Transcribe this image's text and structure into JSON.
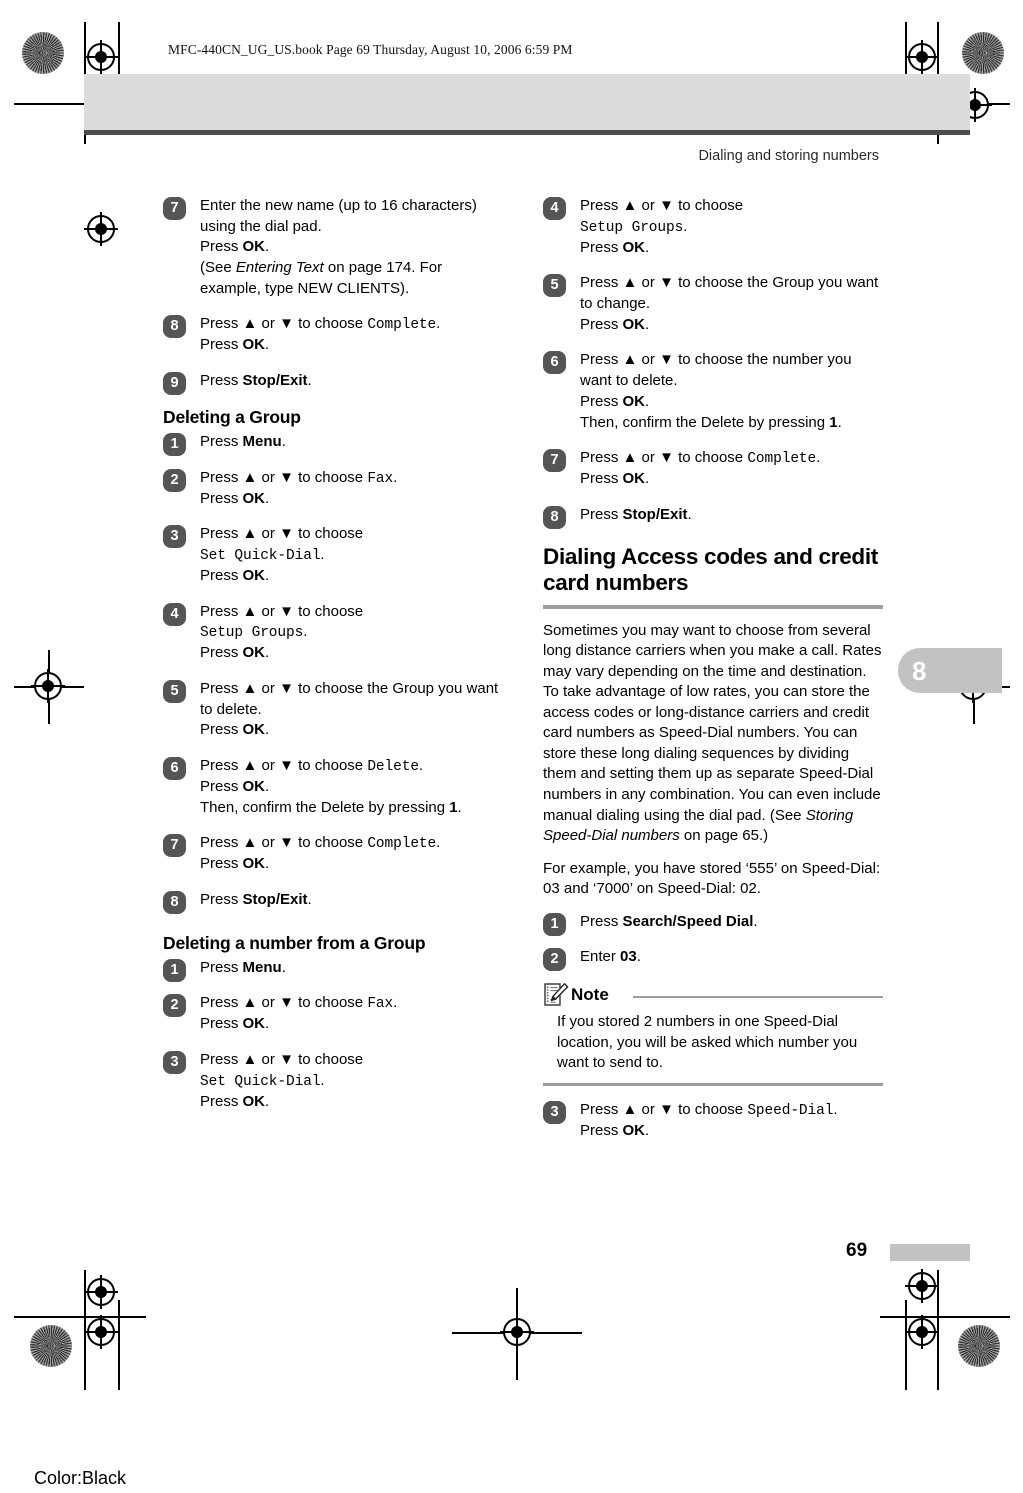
{
  "print_marks": {
    "book_line": "MFC-440CN_UG_US.book  Page 69  Thursday, August 10, 2006  6:59 PM",
    "color_note": "Color:Black"
  },
  "header": {
    "running_head": "Dialing and storing numbers"
  },
  "chapter_tab": {
    "number": "8"
  },
  "footer": {
    "page_number": "69"
  },
  "left_column": {
    "continued_steps": [
      {
        "number": "7",
        "lines": [
          [
            {
              "t": "Enter the new name (up to 16 characters) using the dial pad.",
              "s": "plain"
            }
          ],
          [
            {
              "t": "Press ",
              "s": "plain"
            },
            {
              "t": "OK",
              "s": "bold"
            },
            {
              "t": ".",
              "s": "plain"
            }
          ],
          [
            {
              "t": "(See ",
              "s": "plain"
            },
            {
              "t": "Entering Text",
              "s": "italic"
            },
            {
              "t": " on page 174. For example, type NEW CLIENTS).",
              "s": "plain"
            }
          ]
        ]
      },
      {
        "number": "8",
        "lines": [
          [
            {
              "t": "Press ",
              "s": "plain"
            },
            {
              "t": "▲",
              "s": "bold"
            },
            {
              "t": " or ",
              "s": "plain"
            },
            {
              "t": "▼",
              "s": "bold"
            },
            {
              "t": " to choose ",
              "s": "plain"
            },
            {
              "t": "Complete",
              "s": "lcd"
            },
            {
              "t": ".",
              "s": "plain"
            }
          ],
          [
            {
              "t": "Press ",
              "s": "plain"
            },
            {
              "t": "OK",
              "s": "bold"
            },
            {
              "t": ".",
              "s": "plain"
            }
          ]
        ]
      },
      {
        "number": "9",
        "lines": [
          [
            {
              "t": "Press ",
              "s": "plain"
            },
            {
              "t": "Stop/Exit",
              "s": "bold"
            },
            {
              "t": ".",
              "s": "plain"
            }
          ]
        ]
      }
    ],
    "section_deleting_group": {
      "heading": "Deleting a Group",
      "steps": [
        {
          "number": "1",
          "lines": [
            [
              {
                "t": "Press ",
                "s": "plain"
              },
              {
                "t": "Menu",
                "s": "bold"
              },
              {
                "t": ".",
                "s": "plain"
              }
            ]
          ]
        },
        {
          "number": "2",
          "lines": [
            [
              {
                "t": "Press ",
                "s": "plain"
              },
              {
                "t": "▲",
                "s": "bold"
              },
              {
                "t": " or ",
                "s": "plain"
              },
              {
                "t": "▼",
                "s": "bold"
              },
              {
                "t": " to choose ",
                "s": "plain"
              },
              {
                "t": "Fax",
                "s": "lcd"
              },
              {
                "t": ".",
                "s": "plain"
              }
            ],
            [
              {
                "t": "Press ",
                "s": "plain"
              },
              {
                "t": "OK",
                "s": "bold"
              },
              {
                "t": ".",
                "s": "plain"
              }
            ]
          ]
        },
        {
          "number": "3",
          "lines": [
            [
              {
                "t": "Press ",
                "s": "plain"
              },
              {
                "t": "▲",
                "s": "bold"
              },
              {
                "t": " or ",
                "s": "plain"
              },
              {
                "t": "▼",
                "s": "bold"
              },
              {
                "t": " to choose",
                "s": "plain"
              }
            ],
            [
              {
                "t": "Set Quick-Dial",
                "s": "lcd"
              },
              {
                "t": ".",
                "s": "plain"
              }
            ],
            [
              {
                "t": "Press ",
                "s": "plain"
              },
              {
                "t": "OK",
                "s": "bold"
              },
              {
                "t": ".",
                "s": "plain"
              }
            ]
          ]
        },
        {
          "number": "4",
          "lines": [
            [
              {
                "t": "Press ",
                "s": "plain"
              },
              {
                "t": "▲",
                "s": "bold"
              },
              {
                "t": " or ",
                "s": "plain"
              },
              {
                "t": "▼",
                "s": "bold"
              },
              {
                "t": " to choose",
                "s": "plain"
              }
            ],
            [
              {
                "t": "Setup Groups",
                "s": "lcd"
              },
              {
                "t": ".",
                "s": "plain"
              }
            ],
            [
              {
                "t": "Press ",
                "s": "plain"
              },
              {
                "t": "OK",
                "s": "bold"
              },
              {
                "t": ".",
                "s": "plain"
              }
            ]
          ]
        },
        {
          "number": "5",
          "lines": [
            [
              {
                "t": "Press ",
                "s": "plain"
              },
              {
                "t": "▲",
                "s": "bold"
              },
              {
                "t": " or ",
                "s": "plain"
              },
              {
                "t": "▼",
                "s": "bold"
              },
              {
                "t": " to choose the Group you want to delete.",
                "s": "plain"
              }
            ],
            [
              {
                "t": "Press ",
                "s": "plain"
              },
              {
                "t": "OK",
                "s": "bold"
              },
              {
                "t": ".",
                "s": "plain"
              }
            ]
          ]
        },
        {
          "number": "6",
          "lines": [
            [
              {
                "t": "Press ",
                "s": "plain"
              },
              {
                "t": "▲",
                "s": "bold"
              },
              {
                "t": " or ",
                "s": "plain"
              },
              {
                "t": "▼",
                "s": "bold"
              },
              {
                "t": " to choose ",
                "s": "plain"
              },
              {
                "t": "Delete",
                "s": "lcd"
              },
              {
                "t": ".",
                "s": "plain"
              }
            ],
            [
              {
                "t": "Press ",
                "s": "plain"
              },
              {
                "t": "OK",
                "s": "bold"
              },
              {
                "t": ".",
                "s": "plain"
              }
            ],
            [
              {
                "t": "Then, confirm the Delete by pressing ",
                "s": "plain"
              },
              {
                "t": "1",
                "s": "bold"
              },
              {
                "t": ".",
                "s": "plain"
              }
            ]
          ]
        },
        {
          "number": "7",
          "lines": [
            [
              {
                "t": "Press ",
                "s": "plain"
              },
              {
                "t": "▲",
                "s": "bold"
              },
              {
                "t": " or ",
                "s": "plain"
              },
              {
                "t": "▼",
                "s": "bold"
              },
              {
                "t": " to choose ",
                "s": "plain"
              },
              {
                "t": "Complete",
                "s": "lcd"
              },
              {
                "t": ".",
                "s": "plain"
              }
            ],
            [
              {
                "t": "Press ",
                "s": "plain"
              },
              {
                "t": "OK",
                "s": "bold"
              },
              {
                "t": ".",
                "s": "plain"
              }
            ]
          ]
        },
        {
          "number": "8",
          "lines": [
            [
              {
                "t": "Press ",
                "s": "plain"
              },
              {
                "t": "Stop/Exit",
                "s": "bold"
              },
              {
                "t": ".",
                "s": "plain"
              }
            ]
          ]
        }
      ]
    },
    "section_deleting_number": {
      "heading": "Deleting a number from a Group",
      "steps": [
        {
          "number": "1",
          "lines": [
            [
              {
                "t": "Press ",
                "s": "plain"
              },
              {
                "t": "Menu",
                "s": "bold"
              },
              {
                "t": ".",
                "s": "plain"
              }
            ]
          ]
        },
        {
          "number": "2",
          "lines": [
            [
              {
                "t": "Press ",
                "s": "plain"
              },
              {
                "t": "▲",
                "s": "bold"
              },
              {
                "t": " or ",
                "s": "plain"
              },
              {
                "t": "▼",
                "s": "bold"
              },
              {
                "t": " to choose ",
                "s": "plain"
              },
              {
                "t": "Fax",
                "s": "lcd"
              },
              {
                "t": ".",
                "s": "plain"
              }
            ],
            [
              {
                "t": "Press ",
                "s": "plain"
              },
              {
                "t": "OK",
                "s": "bold"
              },
              {
                "t": ".",
                "s": "plain"
              }
            ]
          ]
        },
        {
          "number": "3",
          "lines": [
            [
              {
                "t": "Press ",
                "s": "plain"
              },
              {
                "t": "▲",
                "s": "bold"
              },
              {
                "t": " or ",
                "s": "plain"
              },
              {
                "t": "▼",
                "s": "bold"
              },
              {
                "t": " to choose",
                "s": "plain"
              }
            ],
            [
              {
                "t": "Set Quick-Dial",
                "s": "lcd"
              },
              {
                "t": ".",
                "s": "plain"
              }
            ],
            [
              {
                "t": "Press ",
                "s": "plain"
              },
              {
                "t": "OK",
                "s": "bold"
              },
              {
                "t": ".",
                "s": "plain"
              }
            ]
          ]
        }
      ]
    }
  },
  "right_column": {
    "continued_steps": [
      {
        "number": "4",
        "lines": [
          [
            {
              "t": "Press ",
              "s": "plain"
            },
            {
              "t": "▲",
              "s": "bold"
            },
            {
              "t": " or ",
              "s": "plain"
            },
            {
              "t": "▼",
              "s": "bold"
            },
            {
              "t": " to choose",
              "s": "plain"
            }
          ],
          [
            {
              "t": "Setup Groups",
              "s": "lcd"
            },
            {
              "t": ".",
              "s": "plain"
            }
          ],
          [
            {
              "t": "Press ",
              "s": "plain"
            },
            {
              "t": "OK",
              "s": "bold"
            },
            {
              "t": ".",
              "s": "plain"
            }
          ]
        ]
      },
      {
        "number": "5",
        "lines": [
          [
            {
              "t": "Press ",
              "s": "plain"
            },
            {
              "t": "▲",
              "s": "bold"
            },
            {
              "t": " or ",
              "s": "plain"
            },
            {
              "t": "▼",
              "s": "bold"
            },
            {
              "t": " to choose the Group you want to change.",
              "s": "plain"
            }
          ],
          [
            {
              "t": "Press ",
              "s": "plain"
            },
            {
              "t": "OK",
              "s": "bold"
            },
            {
              "t": ".",
              "s": "plain"
            }
          ]
        ]
      },
      {
        "number": "6",
        "lines": [
          [
            {
              "t": "Press ",
              "s": "plain"
            },
            {
              "t": "▲",
              "s": "bold"
            },
            {
              "t": " or ",
              "s": "plain"
            },
            {
              "t": "▼",
              "s": "bold"
            },
            {
              "t": " to choose the number you want to delete.",
              "s": "plain"
            }
          ],
          [
            {
              "t": "Press ",
              "s": "plain"
            },
            {
              "t": "OK",
              "s": "bold"
            },
            {
              "t": ".",
              "s": "plain"
            }
          ],
          [
            {
              "t": "Then, confirm the Delete by pressing ",
              "s": "plain"
            },
            {
              "t": "1",
              "s": "bold"
            },
            {
              "t": ".",
              "s": "plain"
            }
          ]
        ]
      },
      {
        "number": "7",
        "lines": [
          [
            {
              "t": "Press ",
              "s": "plain"
            },
            {
              "t": "▲",
              "s": "bold"
            },
            {
              "t": " or ",
              "s": "plain"
            },
            {
              "t": "▼",
              "s": "bold"
            },
            {
              "t": " to choose ",
              "s": "plain"
            },
            {
              "t": "Complete",
              "s": "lcd"
            },
            {
              "t": ".",
              "s": "plain"
            }
          ],
          [
            {
              "t": "Press ",
              "s": "plain"
            },
            {
              "t": "OK",
              "s": "bold"
            },
            {
              "t": ".",
              "s": "plain"
            }
          ]
        ]
      },
      {
        "number": "8",
        "lines": [
          [
            {
              "t": "Press ",
              "s": "plain"
            },
            {
              "t": "Stop/Exit",
              "s": "bold"
            },
            {
              "t": ".",
              "s": "plain"
            }
          ]
        ]
      }
    ],
    "section_dialing_access": {
      "heading": "Dialing Access codes and credit card numbers",
      "paragraphs": [
        [
          {
            "t": "Sometimes you may want to choose from several long distance carriers when you make a call. Rates may vary depending on the time and destination. To take advantage of low rates, you can store the access codes or long-distance carriers and credit card numbers as Speed-Dial numbers. You can store these long dialing sequences by dividing them and setting them up as separate Speed-Dial numbers in any combination. You can even include manual dialing using the dial pad. (See ",
            "s": "plain"
          },
          {
            "t": "Storing Speed-Dial numbers",
            "s": "italic"
          },
          {
            "t": " on page 65.)",
            "s": "plain"
          }
        ],
        [
          {
            "t": "For example, you have stored ‘555’ on Speed-Dial: 03 and ‘7000’ on Speed-Dial: 02.",
            "s": "plain"
          }
        ]
      ],
      "steps_before_note": [
        {
          "number": "1",
          "lines": [
            [
              {
                "t": "Press ",
                "s": "plain"
              },
              {
                "t": "Search/Speed Dial",
                "s": "bold"
              },
              {
                "t": ".",
                "s": "plain"
              }
            ]
          ]
        },
        {
          "number": "2",
          "lines": [
            [
              {
                "t": "Enter ",
                "s": "plain"
              },
              {
                "t": "03",
                "s": "bold"
              },
              {
                "t": ".",
                "s": "plain"
              }
            ]
          ]
        }
      ],
      "note": {
        "title": "Note",
        "body": "If you stored 2 numbers in one Speed-Dial location, you will be asked which number you want to send to."
      },
      "steps_after_note": [
        {
          "number": "3",
          "lines": [
            [
              {
                "t": "Press ",
                "s": "plain"
              },
              {
                "t": "▲",
                "s": "bold"
              },
              {
                "t": " or ",
                "s": "plain"
              },
              {
                "t": "▼",
                "s": "bold"
              },
              {
                "t": " to choose ",
                "s": "plain"
              },
              {
                "t": "Speed-Dial",
                "s": "lcd"
              },
              {
                "t": ".",
                "s": "plain"
              }
            ],
            [
              {
                "t": "Press ",
                "s": "plain"
              },
              {
                "t": "OK",
                "s": "bold"
              },
              {
                "t": ".",
                "s": "plain"
              }
            ]
          ]
        }
      ]
    }
  }
}
